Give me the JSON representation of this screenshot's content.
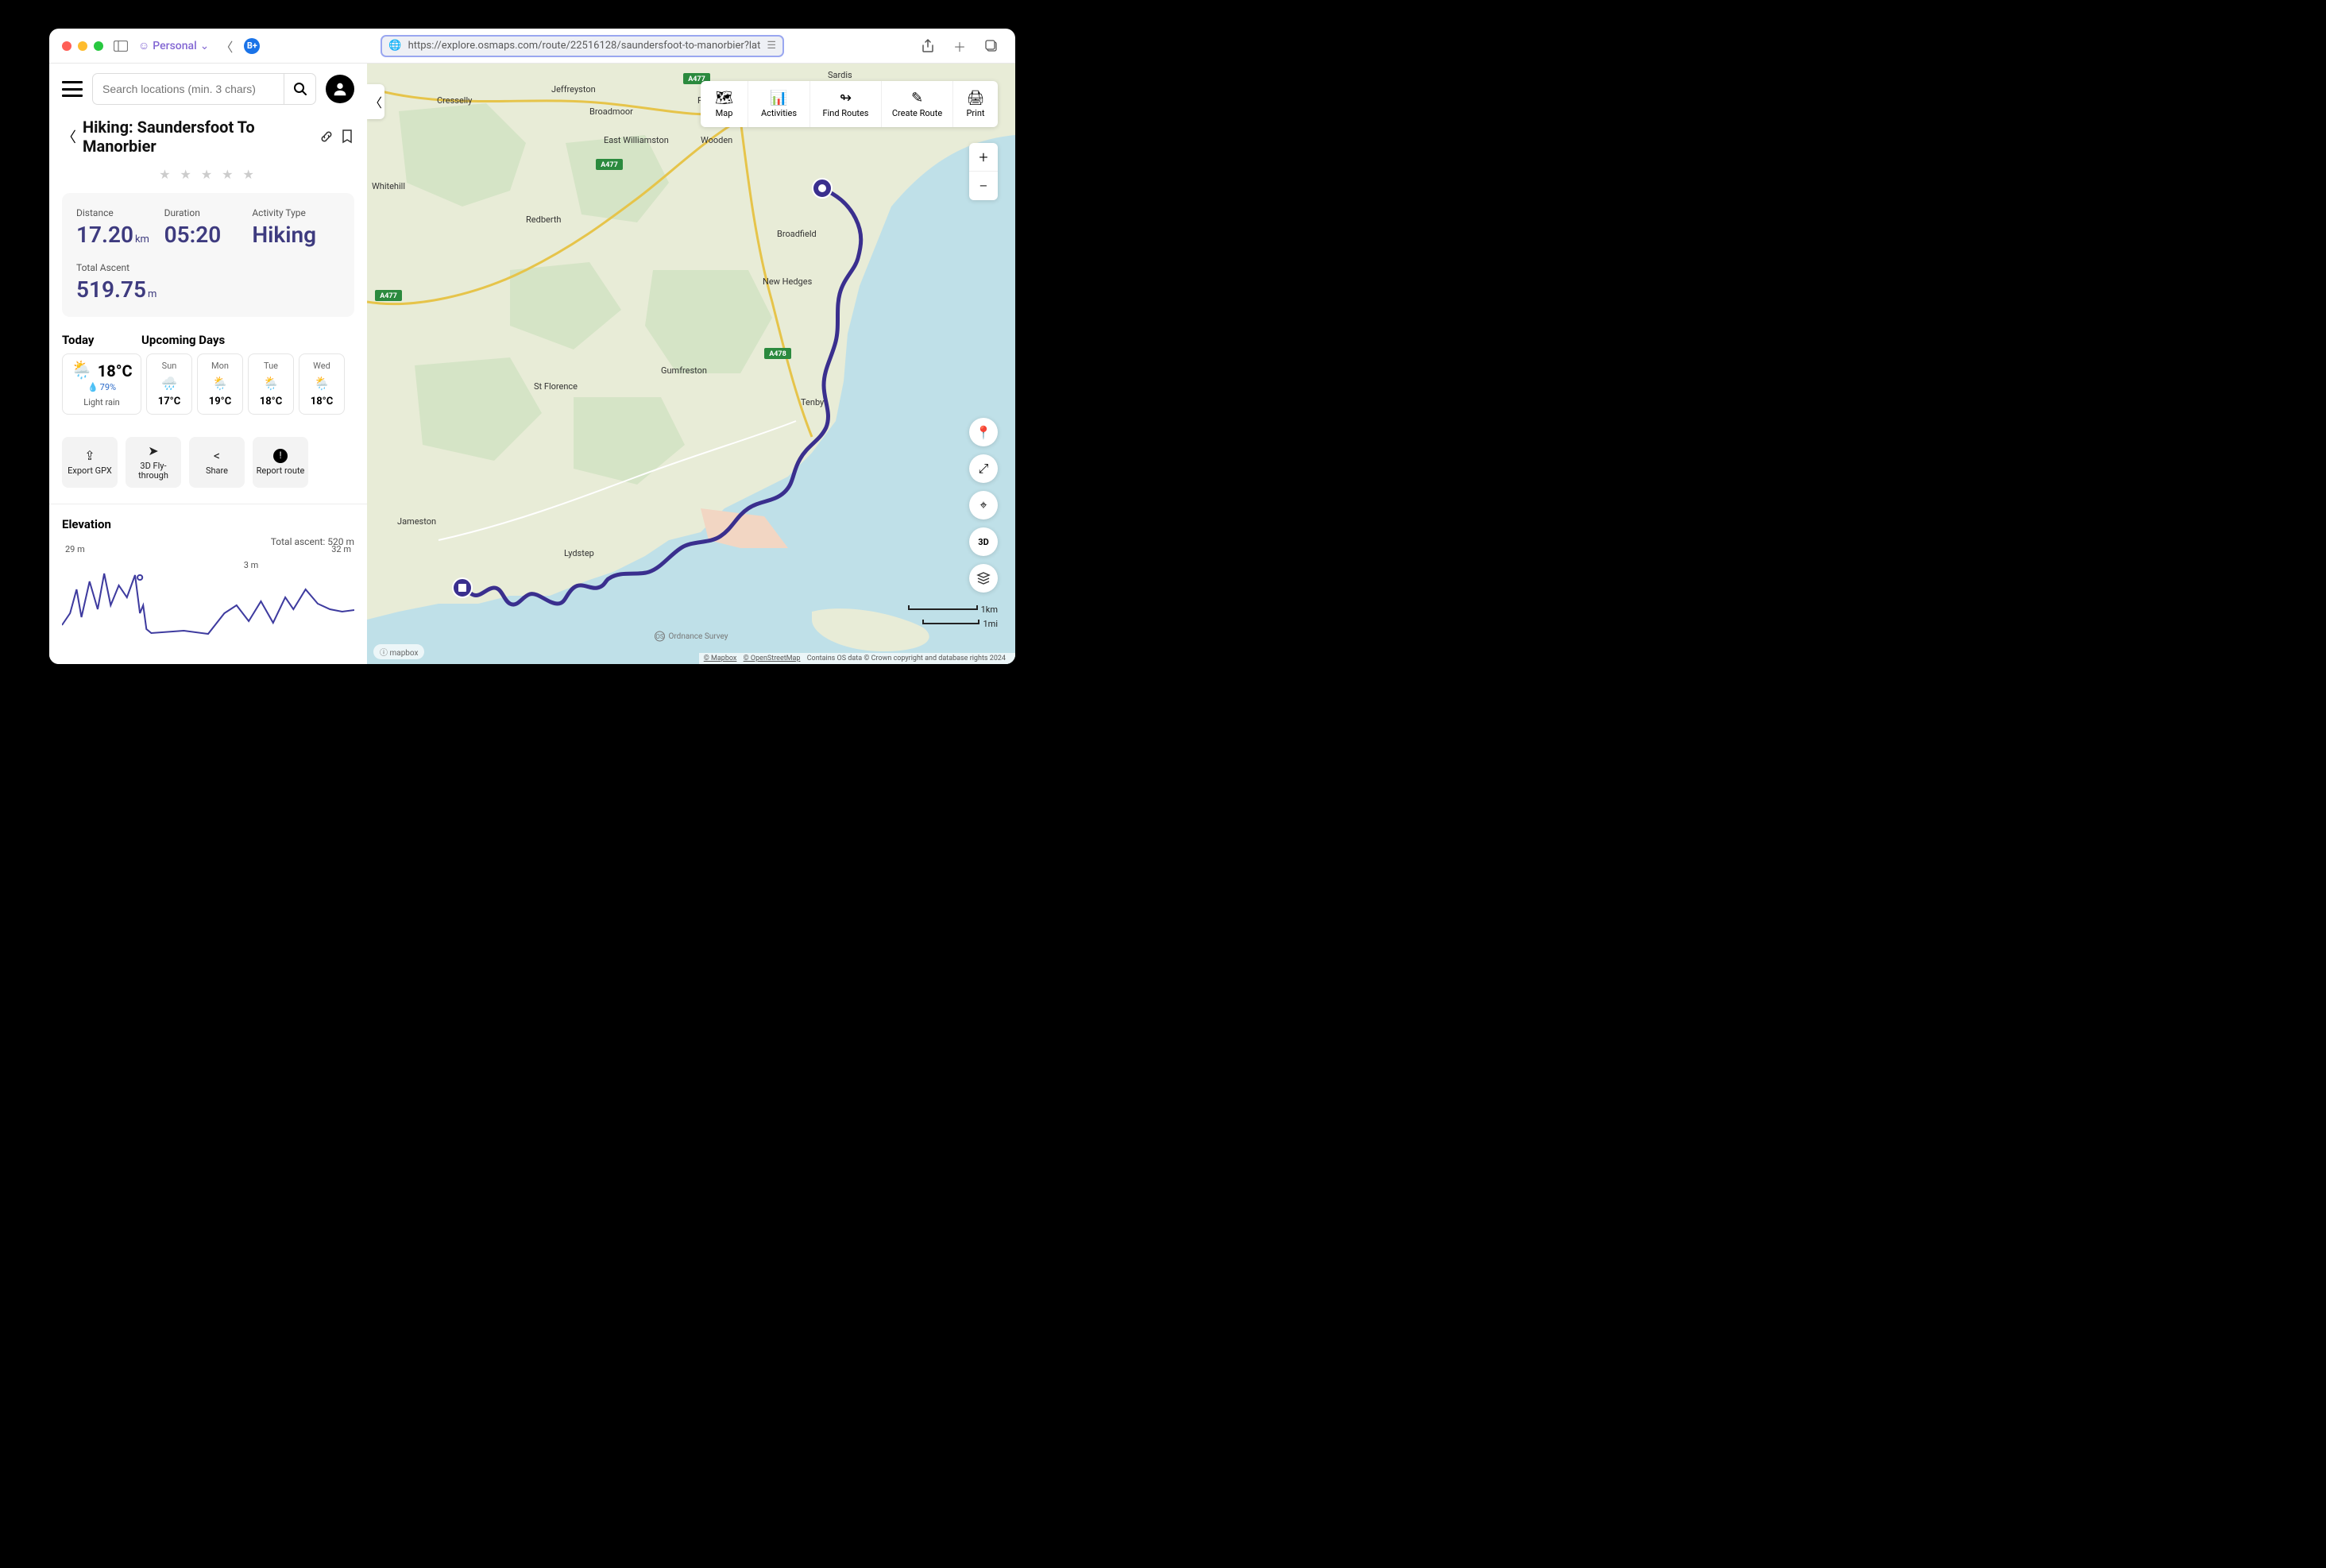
{
  "browser": {
    "profile_label": "Personal",
    "url": "https://explore.osmaps.com/route/22516128/saundersfoot-to-manorbier?lat",
    "bplus": "B+"
  },
  "search": {
    "placeholder": "Search locations (min. 3 chars)"
  },
  "route": {
    "title": "Hiking: Saundersfoot To Manorbier",
    "stars": "★ ★ ★ ★ ★"
  },
  "stats": {
    "distance_label": "Distance",
    "distance_value": "17.20",
    "distance_unit": "km",
    "duration_label": "Duration",
    "duration_value": "05:20",
    "activity_label": "Activity Type",
    "activity_value": "Hiking",
    "ascent_label": "Total Ascent",
    "ascent_value": "519.75",
    "ascent_unit": "m"
  },
  "weather": {
    "today_heading": "Today",
    "upcoming_heading": "Upcoming Days",
    "today": {
      "temp": "18°C",
      "precip": "79%",
      "condition": "Light rain"
    },
    "days": [
      {
        "name": "Sun",
        "temp": "17°C"
      },
      {
        "name": "Mon",
        "temp": "19°C"
      },
      {
        "name": "Tue",
        "temp": "18°C"
      },
      {
        "name": "Wed",
        "temp": "18°C"
      }
    ]
  },
  "actions": {
    "export": "Export GPX",
    "fly": "3D Fly-through",
    "share": "Share",
    "report": "Report route"
  },
  "elevation": {
    "heading": "Elevation",
    "total_ascent": "Total ascent: 520 m",
    "start": "29 m",
    "mid": "3 m",
    "end": "32 m"
  },
  "toolbar": {
    "map": "Map",
    "activities": "Activities",
    "find": "Find Routes",
    "create": "Create Route",
    "print": "Print"
  },
  "scale": {
    "km": "1km",
    "mi": "1mi"
  },
  "map_labels": {
    "cresselly": "Cresselly",
    "jeffreyston": "Jeffreyston",
    "broadmoor": "Broadmoor",
    "pentle": "Pentle",
    "sardis": "Sardis",
    "wooden": "Wooden",
    "whitehill": "Whitehill",
    "east_williamston": "East\nWilliamston",
    "redberth": "Redberth",
    "broadfield": "Broadfield",
    "new_hedges": "New Hedges",
    "gumfreston": "Gumfreston",
    "tenby": "Tenby",
    "st_florence": "St Florence",
    "jameston": "Jameston",
    "lydstep": "Lydstep",
    "a477_1": "A477",
    "a477_2": "A477",
    "a477_3": "A477",
    "a478": "A478"
  },
  "attribution": {
    "os": "Ordnance Survey",
    "mapbox_badge": "ⓘ mapbox",
    "mapbox": "© Mapbox",
    "osm": "© OpenStreetMap",
    "rest": "Contains OS data © Crown copyright and database rights 2024"
  }
}
